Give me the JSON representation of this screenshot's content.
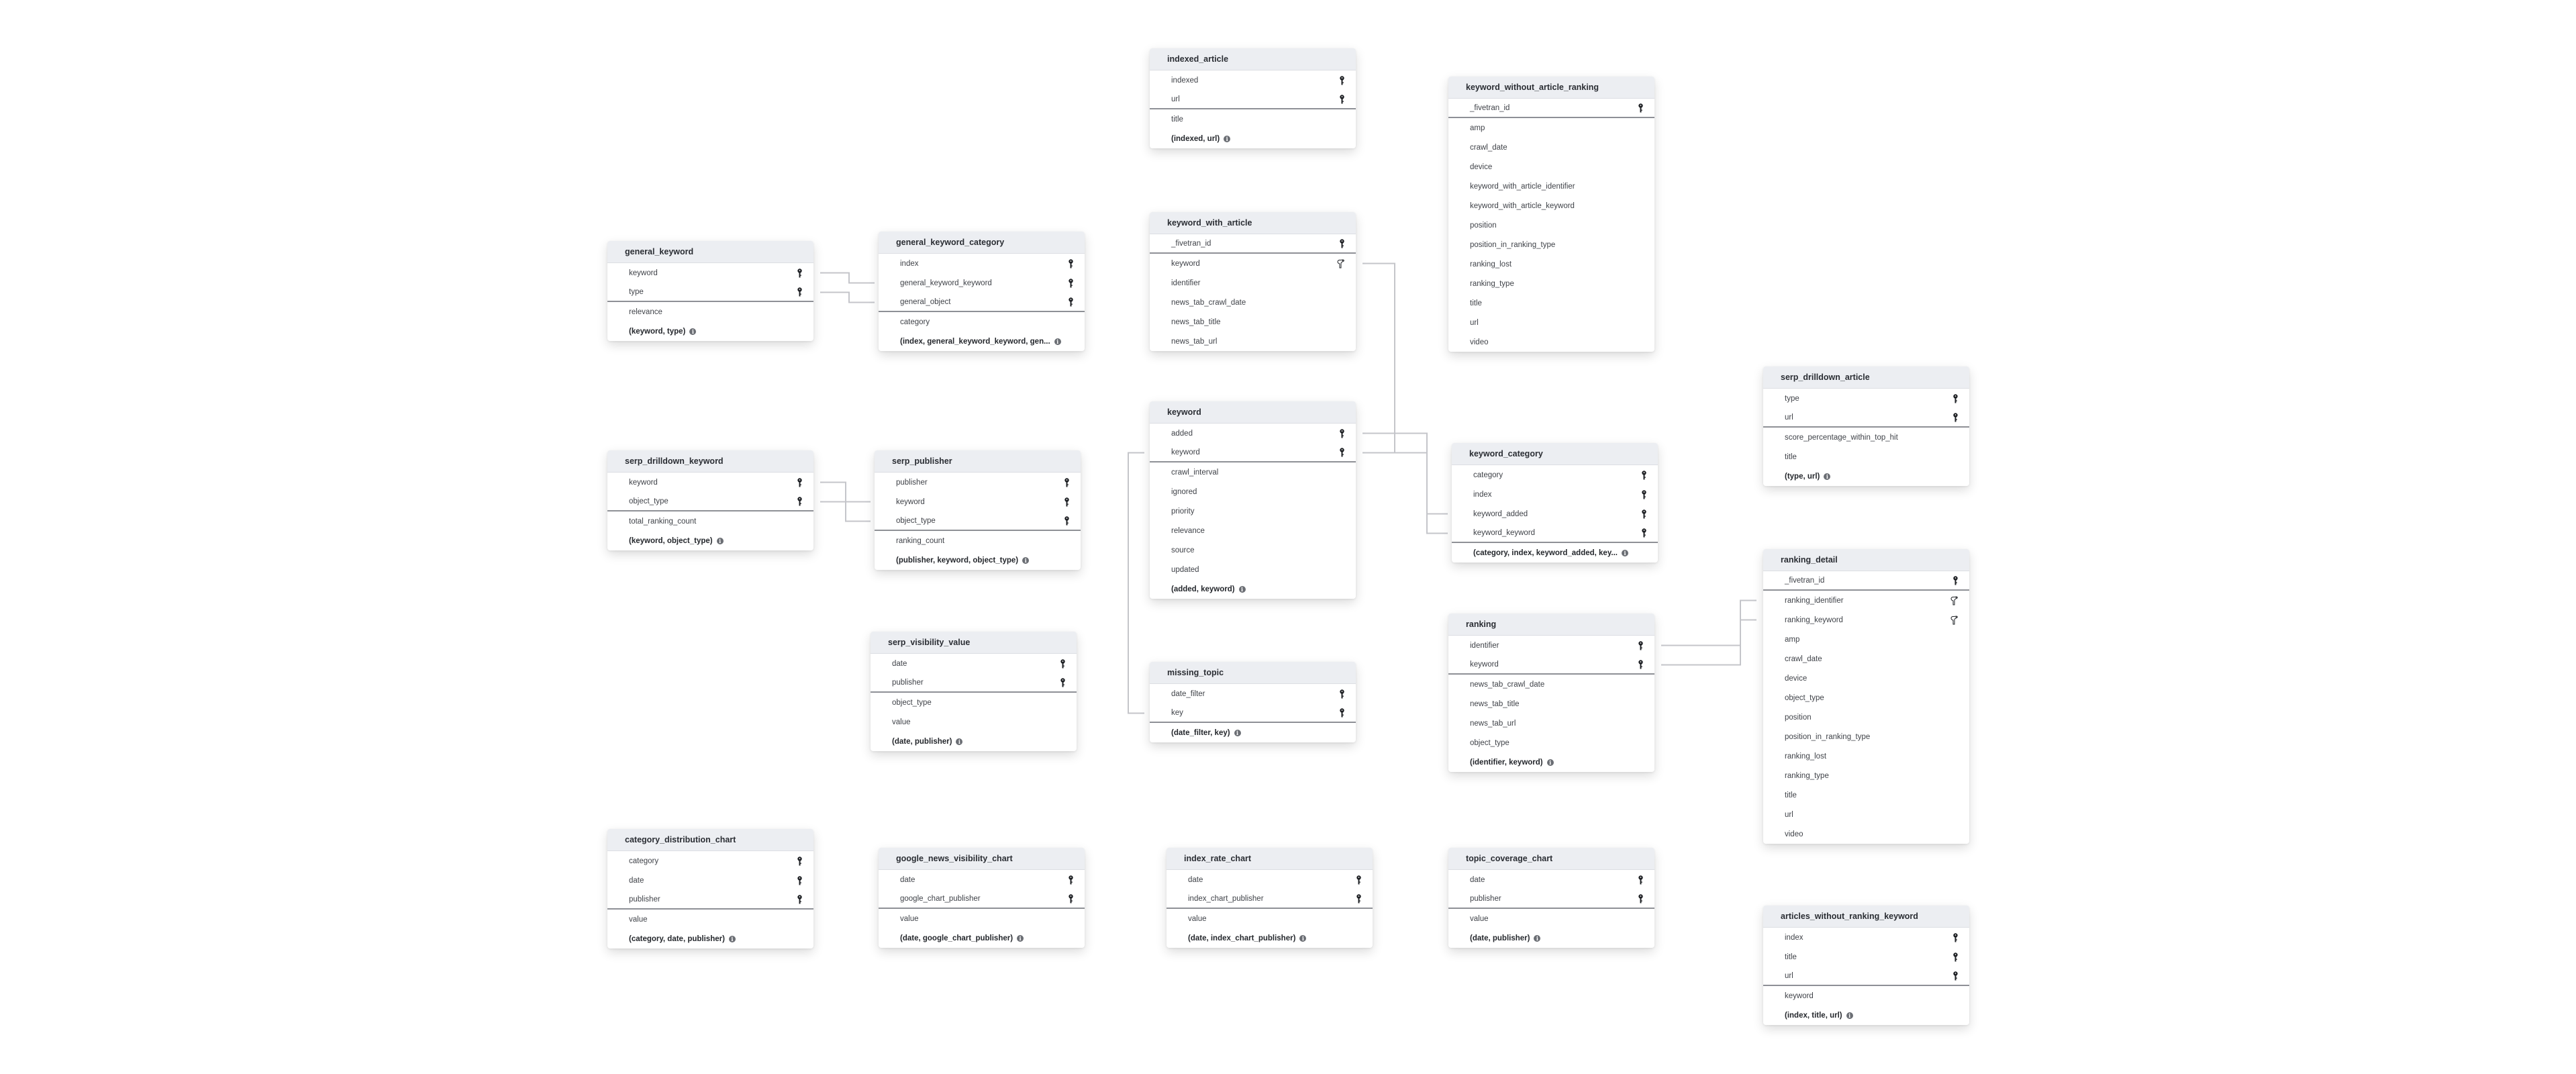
{
  "tables": [
    {
      "id": "indexed_article",
      "name": "indexed_article",
      "pk": [
        "indexed",
        "url"
      ],
      "fk": [],
      "cols": [
        "title"
      ],
      "ck": "(indexed, url)"
    },
    {
      "id": "keyword_without_article_ranking",
      "name": "keyword_without_article_ranking",
      "pk": [
        "_fivetran_id"
      ],
      "fk": [],
      "cols": [
        "amp",
        "crawl_date",
        "device",
        "keyword_with_article_identifier",
        "keyword_with_article_keyword",
        "position",
        "position_in_ranking_type",
        "ranking_lost",
        "ranking_type",
        "title",
        "url",
        "video"
      ],
      "ck": ""
    },
    {
      "id": "general_keyword",
      "name": "general_keyword",
      "pk": [
        "keyword",
        "type"
      ],
      "fk": [],
      "cols": [
        "relevance"
      ],
      "ck": "(keyword, type)"
    },
    {
      "id": "general_keyword_category",
      "name": "general_keyword_category",
      "pk": [
        "index",
        "general_keyword_keyword",
        "general_object"
      ],
      "fk": [],
      "cols": [
        "category"
      ],
      "ck": "(index, general_keyword_keyword, gen..."
    },
    {
      "id": "keyword_with_article",
      "name": "keyword_with_article",
      "pk": [
        "_fivetran_id"
      ],
      "fk": [
        "keyword"
      ],
      "cols": [
        "identifier",
        "news_tab_crawl_date",
        "news_tab_title",
        "news_tab_url"
      ],
      "ck": ""
    },
    {
      "id": "serp_drilldown_keyword",
      "name": "serp_drilldown_keyword",
      "pk": [
        "keyword",
        "object_type"
      ],
      "fk": [],
      "cols": [
        "total_ranking_count"
      ],
      "ck": "(keyword, object_type)"
    },
    {
      "id": "serp_publisher",
      "name": "serp_publisher",
      "pk": [
        "publisher",
        "keyword",
        "object_type"
      ],
      "fk": [],
      "cols": [
        "ranking_count"
      ],
      "ck": "(publisher, keyword, object_type)"
    },
    {
      "id": "keyword",
      "name": "keyword",
      "pk": [
        "added",
        "keyword"
      ],
      "fk": [],
      "cols": [
        "crawl_interval",
        "ignored",
        "priority",
        "relevance",
        "source",
        "updated"
      ],
      "ck": "(added, keyword)"
    },
    {
      "id": "keyword_category",
      "name": "keyword_category",
      "pk": [
        "category",
        "index",
        "keyword_added",
        "keyword_keyword"
      ],
      "fk": [],
      "cols": [],
      "ck": "(category, index, keyword_added, key..."
    },
    {
      "id": "serp_drilldown_article",
      "name": "serp_drilldown_article",
      "pk": [
        "type",
        "url"
      ],
      "fk": [],
      "cols": [
        "score_percentage_within_top_hit",
        "title"
      ],
      "ck": "(type, url)"
    },
    {
      "id": "ranking_detail",
      "name": "ranking_detail",
      "pk": [
        "_fivetran_id"
      ],
      "fk": [
        "ranking_identifier",
        "ranking_keyword"
      ],
      "cols": [
        "amp",
        "crawl_date",
        "device",
        "object_type",
        "position",
        "position_in_ranking_type",
        "ranking_lost",
        "ranking_type",
        "title",
        "url",
        "video"
      ],
      "ck": ""
    },
    {
      "id": "ranking",
      "name": "ranking",
      "pk": [
        "identifier",
        "keyword"
      ],
      "fk": [],
      "cols": [
        "news_tab_crawl_date",
        "news_tab_title",
        "news_tab_url",
        "object_type"
      ],
      "ck": "(identifier, keyword)"
    },
    {
      "id": "serp_visibility_value",
      "name": "serp_visibility_value",
      "pk": [
        "date",
        "publisher"
      ],
      "fk": [],
      "cols": [
        "object_type",
        "value"
      ],
      "ck": "(date, publisher)"
    },
    {
      "id": "missing_topic",
      "name": "missing_topic",
      "pk": [
        "date_filter",
        "key"
      ],
      "fk": [],
      "cols": [],
      "ck": "(date_filter, key)"
    },
    {
      "id": "category_distribution_chart",
      "name": "category_distribution_chart",
      "pk": [
        "category",
        "date",
        "publisher"
      ],
      "fk": [],
      "cols": [
        "value"
      ],
      "ck": "(category, date, publisher)"
    },
    {
      "id": "google_news_visibility_chart",
      "name": "google_news_visibility_chart",
      "pk": [
        "date",
        "google_chart_publisher"
      ],
      "fk": [],
      "cols": [
        "value"
      ],
      "ck": "(date, google_chart_publisher)"
    },
    {
      "id": "index_rate_chart",
      "name": "index_rate_chart",
      "pk": [
        "date",
        "index_chart_publisher"
      ],
      "fk": [],
      "cols": [
        "value"
      ],
      "ck": "(date, index_chart_publisher)"
    },
    {
      "id": "topic_coverage_chart",
      "name": "topic_coverage_chart",
      "pk": [
        "date",
        "publisher"
      ],
      "fk": [],
      "cols": [
        "value"
      ],
      "ck": "(date, publisher)"
    },
    {
      "id": "articles_without_ranking_keyword",
      "name": "articles_without_ranking_keyword",
      "pk": [
        "index",
        "title",
        "url"
      ],
      "fk": [],
      "cols": [
        "keyword"
      ],
      "ck": "(index, title, url)"
    }
  ],
  "icons": {
    "primary_key": "key-icon",
    "foreign_key": "foreign-key-icon",
    "composite_key_info": "info-icon"
  }
}
